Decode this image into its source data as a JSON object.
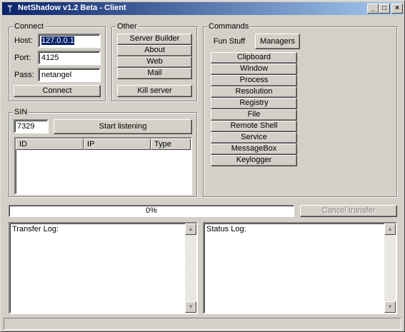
{
  "window": {
    "title": "NetShadow v1.2 Beta  - Client",
    "minimize": "_",
    "maximize": "□",
    "close": "×"
  },
  "connect": {
    "group_label": "Connect",
    "host_label": "Host:",
    "host_value": "127.0.0.1",
    "port_label": "Port:",
    "port_value": "4125",
    "pass_label": "Pass:",
    "pass_value": "netangel",
    "connect_button": "Connect"
  },
  "other": {
    "group_label": "Other",
    "buttons": [
      "Server Builder",
      "About",
      "Web",
      "Mail"
    ],
    "kill_server": "Kill server"
  },
  "sin": {
    "group_label": "SIN",
    "port_value": "7329",
    "start_button": "Start listening",
    "columns": [
      "ID",
      "IP",
      "Type"
    ]
  },
  "commands": {
    "group_label": "Commands",
    "tabs": [
      "Fun Stuff",
      "Managers"
    ],
    "active_tab": "Managers",
    "buttons": [
      "Clipboard",
      "Window",
      "Process",
      "Resolution",
      "Registry",
      "File",
      "Remote Shell",
      "Service",
      "MessageBox",
      "Keylogger"
    ]
  },
  "transfer": {
    "progress_text": "0%",
    "progress_value": 0,
    "cancel_button": "Cancel transfer"
  },
  "logs": {
    "transfer_log": "Transfer Log:",
    "status_log": "Status Log:"
  },
  "icons": {
    "app": "netshadow-icon",
    "scroll_up": "▲",
    "scroll_down": "▼"
  }
}
